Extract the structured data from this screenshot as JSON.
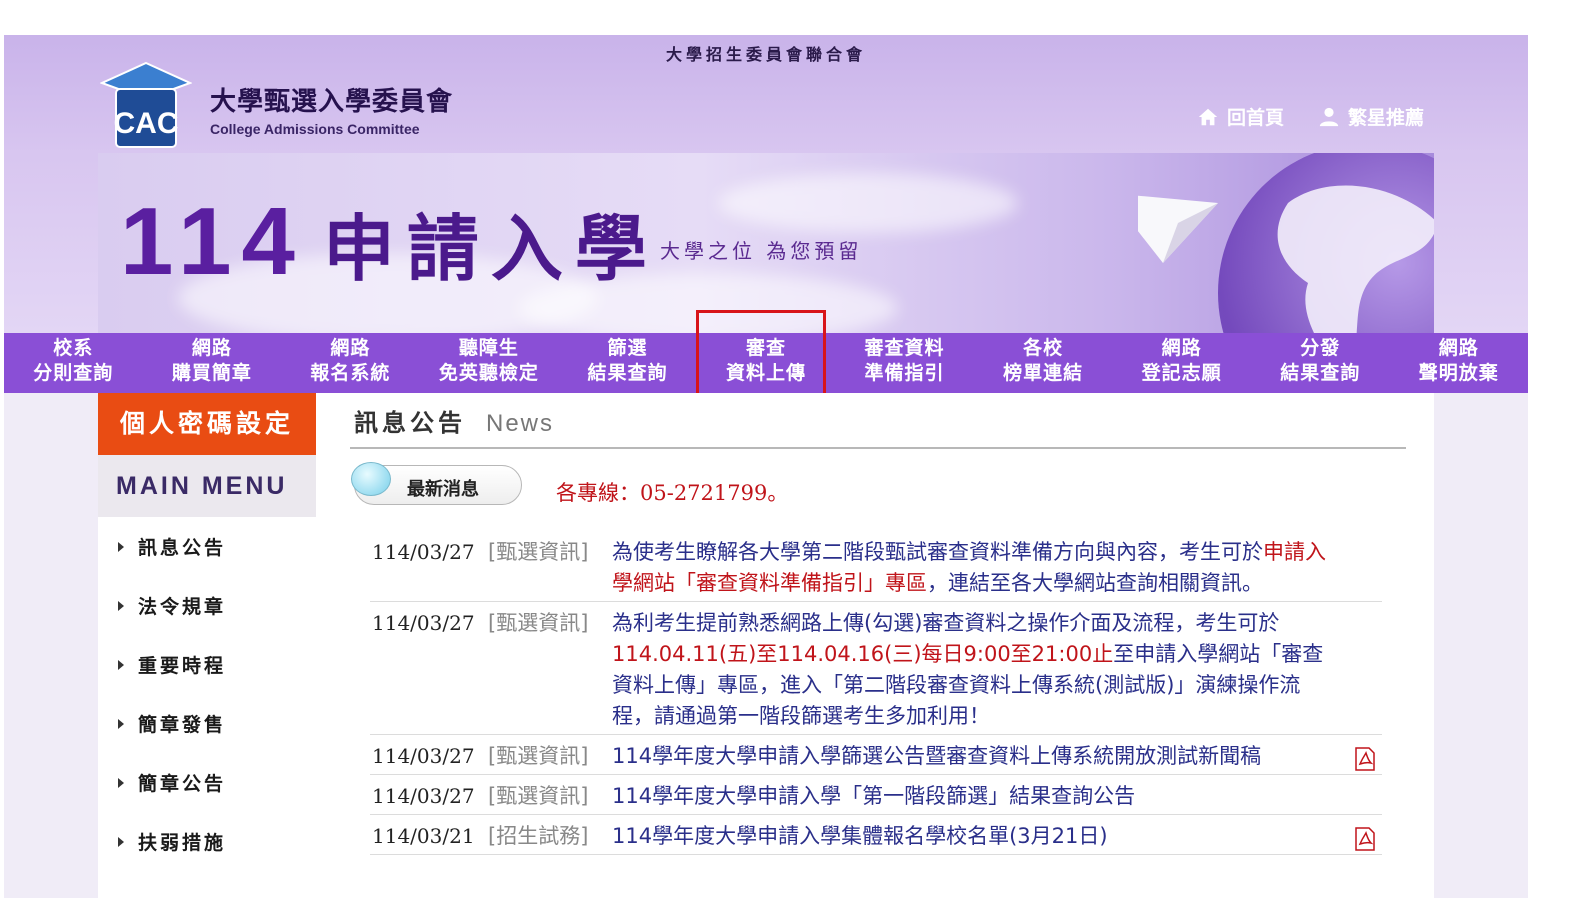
{
  "header": {
    "top_strip": "大學招生委員會聯合會",
    "org_name_cn": "大學甄選入學委員會",
    "org_name_en": "College Admissions Committee",
    "logo_text": "CAC",
    "links": [
      {
        "label": "回首頁",
        "icon": "home-icon"
      },
      {
        "label": "繁星推薦",
        "icon": "user-icon"
      }
    ]
  },
  "banner": {
    "year": "114",
    "title": "申請入學",
    "slogan": "大學之位 為您預留"
  },
  "nav": {
    "items": [
      {
        "l1": "校系",
        "l2": "分則查詢"
      },
      {
        "l1": "網路",
        "l2": "購買簡章"
      },
      {
        "l1": "網路",
        "l2": "報名系統"
      },
      {
        "l1": "聽障生",
        "l2": "免英聽檢定"
      },
      {
        "l1": "篩選",
        "l2": "結果查詢"
      },
      {
        "l1": "審查",
        "l2": "資料上傳"
      },
      {
        "l1": "審查資料",
        "l2": "準備指引"
      },
      {
        "l1": "各校",
        "l2": "榜單連結"
      },
      {
        "l1": "網路",
        "l2": "登記志願"
      },
      {
        "l1": "分發",
        "l2": "結果查詢"
      },
      {
        "l1": "網路",
        "l2": "聲明放棄"
      }
    ],
    "highlight_color": "#d8141a"
  },
  "sidebar": {
    "password_button": "個人密碼設定",
    "main_menu_heading": "MAIN MENU",
    "items": [
      "訊息公告",
      "法令規章",
      "重要時程",
      "簡章發售",
      "簡章公告",
      "扶弱措施"
    ]
  },
  "content": {
    "title_cn": "訊息公告",
    "title_en": "News",
    "latest_button": "最新消息",
    "hotline": "各專線：05-2721799。",
    "news": [
      {
        "date": "114/03/27",
        "category": "[甄選資訊]",
        "parts": [
          {
            "t": "為使考生瞭解各大學第二階段甄試審查資料準備方向與內容，考生可於"
          },
          {
            "t": "申請入學網站「審查資料準備指引」專區",
            "red": true
          },
          {
            "t": "，連結至各大學網站查詢相關資訊。"
          }
        ],
        "pdf": false
      },
      {
        "date": "114/03/27",
        "category": "[甄選資訊]",
        "parts": [
          {
            "t": "為利考生提前熟悉網路上傳(勾選)審查資料之操作介面及流程，考生可於"
          },
          {
            "t": "114.04.11(五)至114.04.16(三)每日9:00至21:00止",
            "red": true
          },
          {
            "t": "至申請入學網站「審查資料上傳」專區，進入「第二階段審查資料上傳系統(測試版)」演練操作流程，請通過第一階段篩選考生多加利用！"
          }
        ],
        "pdf": false
      },
      {
        "date": "114/03/27",
        "category": "[甄選資訊]",
        "parts": [
          {
            "t": "114學年度大學申請入學篩選公告暨審查資料上傳系統開放測試新聞稿"
          }
        ],
        "pdf": true
      },
      {
        "date": "114/03/27",
        "category": "[甄選資訊]",
        "parts": [
          {
            "t": "114學年度大學申請入學「第一階段篩選」結果查詢公告"
          }
        ],
        "pdf": false
      },
      {
        "date": "114/03/21",
        "category": "[招生試務]",
        "parts": [
          {
            "t": "114學年度大學申請入學集體報名學校名單(3月21日)"
          }
        ],
        "pdf": true
      }
    ]
  },
  "colors": {
    "nav_bg": "#8a4fd6",
    "password_btn": "#e94c13",
    "news_link": "#2a2f8a",
    "accent_red": "#c0141a"
  }
}
